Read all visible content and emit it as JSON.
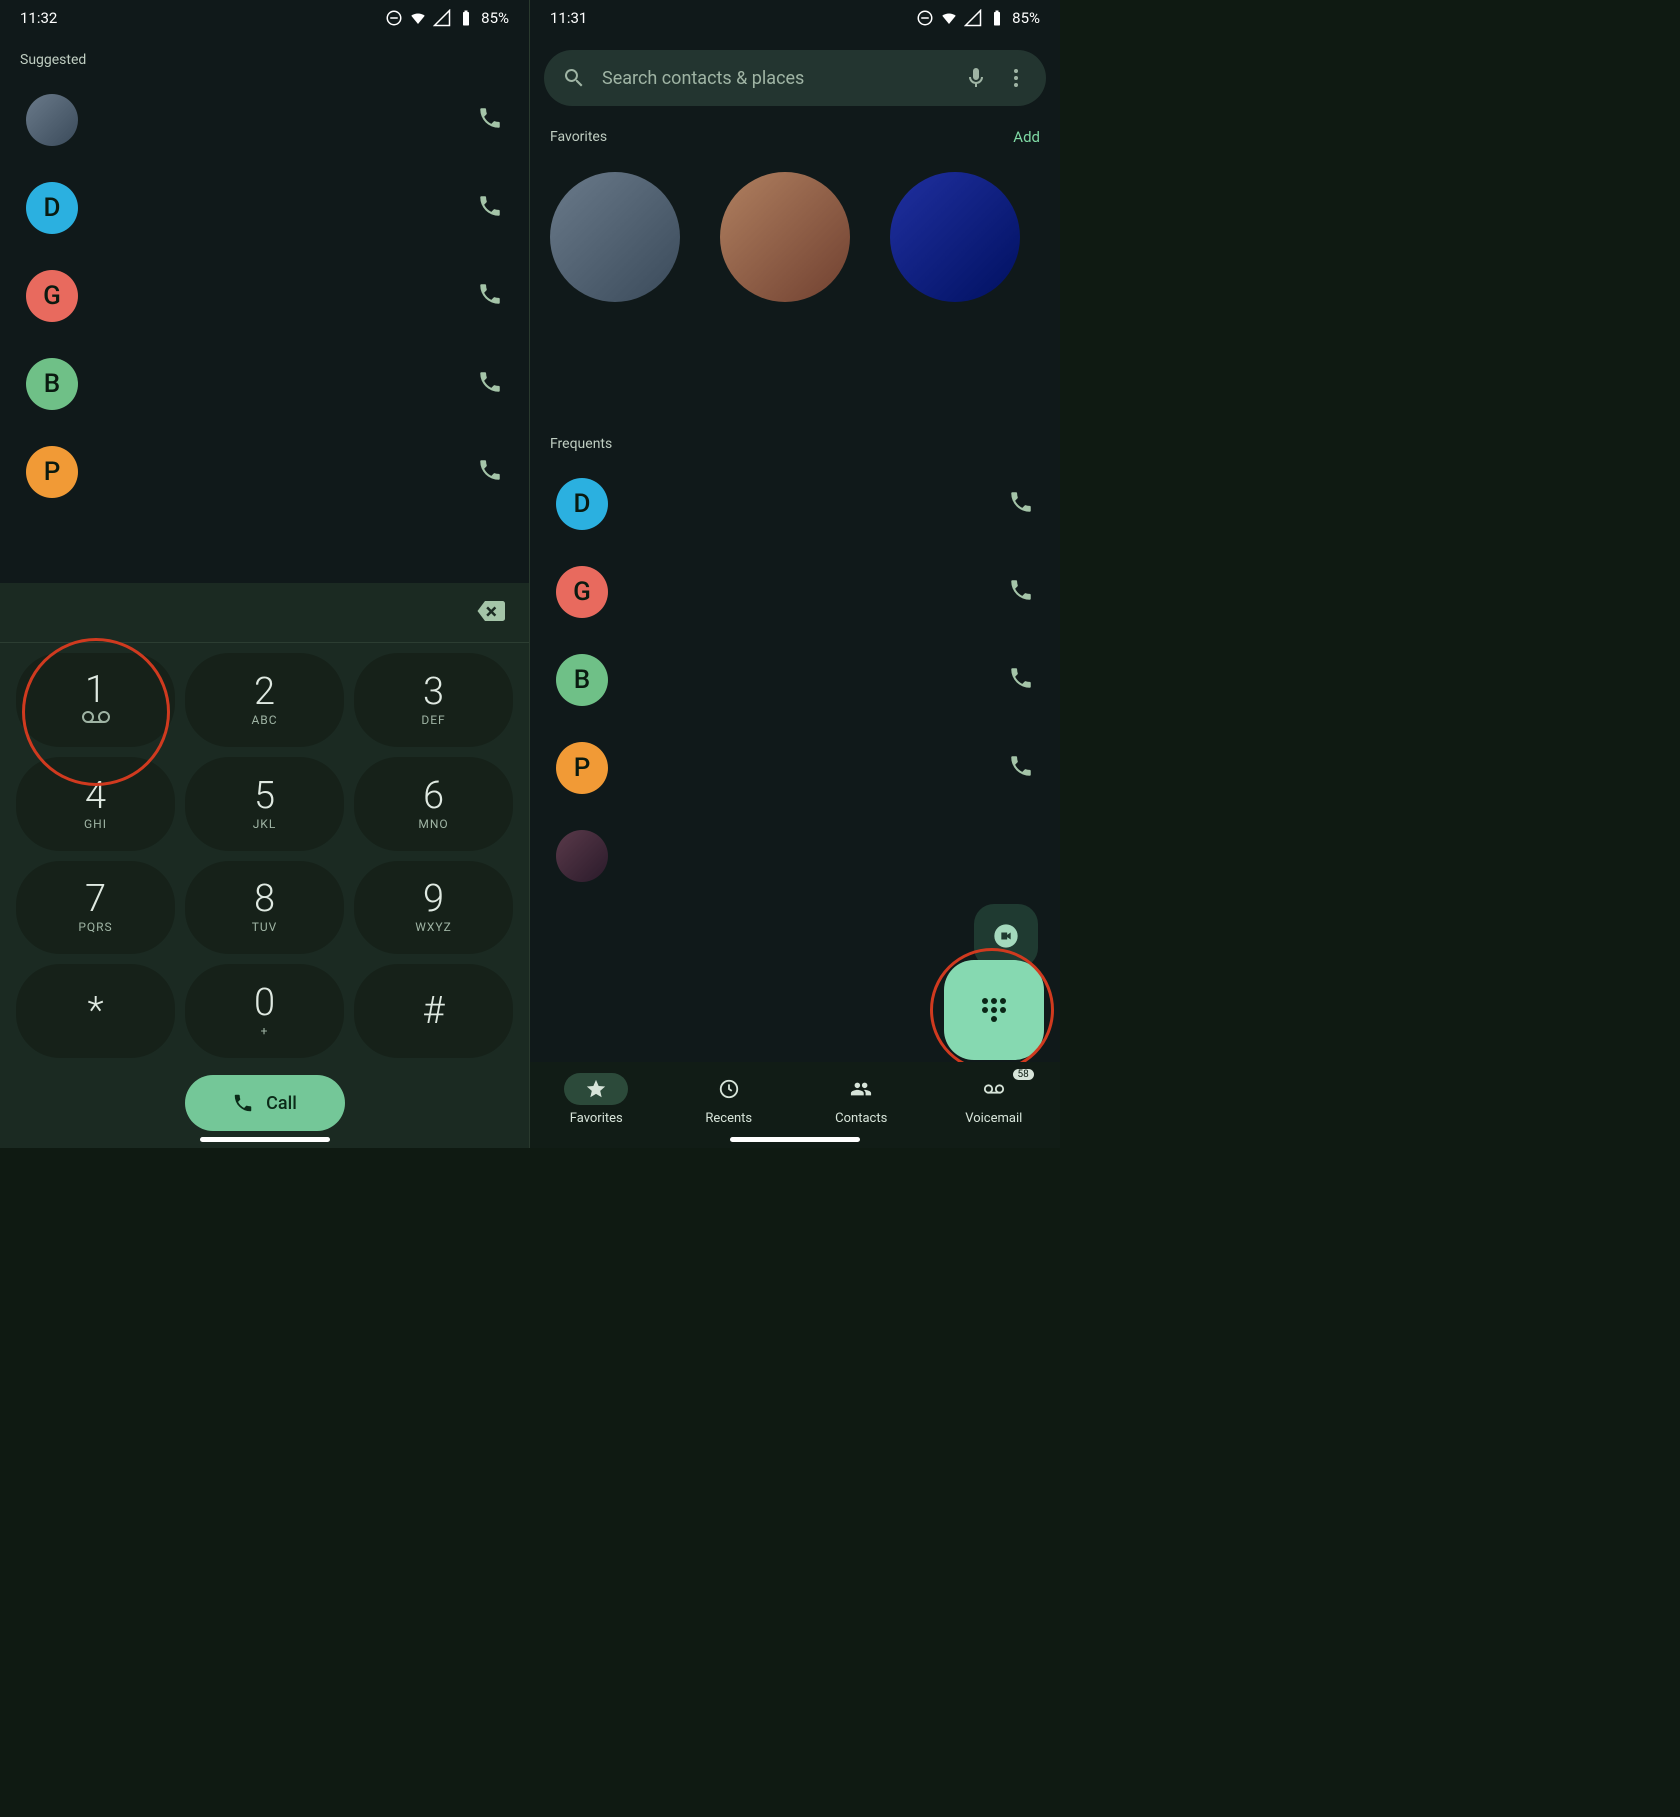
{
  "left": {
    "status": {
      "time": "11:32",
      "battery": "85%"
    },
    "section_label": "Suggested",
    "contacts": [
      {
        "letter": "",
        "color": "photo"
      },
      {
        "letter": "D",
        "color": "#2bb0e0"
      },
      {
        "letter": "G",
        "color": "#e86a5e"
      },
      {
        "letter": "B",
        "color": "#6fc087"
      },
      {
        "letter": "P",
        "color": "#f19a36"
      }
    ],
    "keys": [
      {
        "num": "1",
        "sub": "vm"
      },
      {
        "num": "2",
        "sub": "ABC"
      },
      {
        "num": "3",
        "sub": "DEF"
      },
      {
        "num": "4",
        "sub": "GHI"
      },
      {
        "num": "5",
        "sub": "JKL"
      },
      {
        "num": "6",
        "sub": "MNO"
      },
      {
        "num": "7",
        "sub": "PQRS"
      },
      {
        "num": "8",
        "sub": "TUV"
      },
      {
        "num": "9",
        "sub": "WXYZ"
      },
      {
        "num": "*",
        "sub": ""
      },
      {
        "num": "0",
        "sub": "+"
      },
      {
        "num": "#",
        "sub": ""
      }
    ],
    "call_label": "Call"
  },
  "right": {
    "status": {
      "time": "11:31",
      "battery": "85%"
    },
    "search_placeholder": "Search contacts & places",
    "favorites_label": "Favorites",
    "add_label": "Add",
    "frequents_label": "Frequents",
    "frequents": [
      {
        "letter": "D",
        "color": "#2bb0e0"
      },
      {
        "letter": "G",
        "color": "#e86a5e"
      },
      {
        "letter": "B",
        "color": "#6fc087"
      },
      {
        "letter": "P",
        "color": "#f19a36"
      },
      {
        "letter": "",
        "color": "photo4"
      }
    ],
    "nav": {
      "favorites": "Favorites",
      "recents": "Recents",
      "contacts": "Contacts",
      "voicemail": "Voicemail",
      "vm_badge": "58"
    }
  }
}
